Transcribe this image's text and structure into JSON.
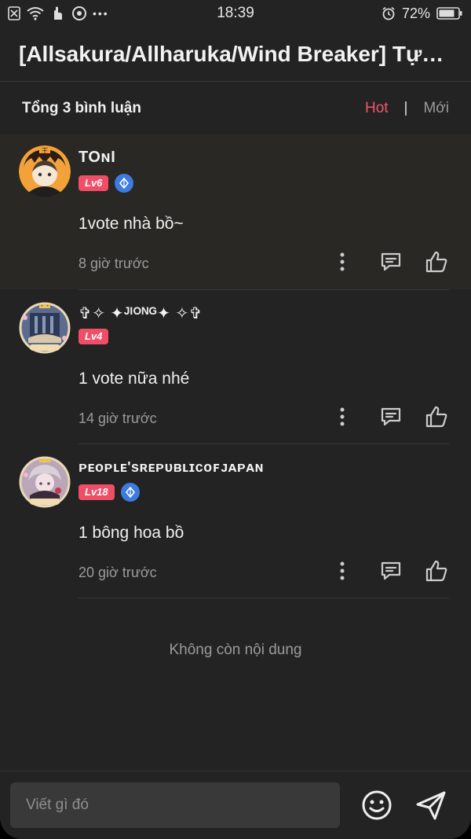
{
  "status_bar": {
    "time": "18:39",
    "battery": "72%",
    "dots": "•••"
  },
  "header": {
    "title": "[Allsakura/Allharuka/Wind Breaker] Tựa..."
  },
  "comment_bar": {
    "count_label": "Tổng 3 bình luận",
    "sort_hot": "Hot",
    "sort_separator": "|",
    "sort_new": "Mới"
  },
  "comments": [
    {
      "username": "TOɴI",
      "level": "Lv6",
      "verified": true,
      "text": "1vote nhà bồ~",
      "time": "8 giờ trước"
    },
    {
      "username": "✞✧ ✦ᴶᴵᴼᴺᴳ✦ ✧✞",
      "level": "Lv4",
      "verified": false,
      "text": "1 vote nữa nhé",
      "time": "14 giờ trước"
    },
    {
      "username": "ᴘᴇᴏᴘʟᴇ'sʀᴇᴘᴜʙʟɪᴄᴏꜰᴊᴀᴘᴀɴ",
      "level": "Lv18",
      "verified": true,
      "text": "1 bông hoa bồ",
      "time": "20 giờ trước"
    }
  ],
  "end_text": "Không còn nội dung",
  "composer": {
    "placeholder": "Viết gì đó"
  },
  "colors": {
    "accent": "#f0556b",
    "level_badge": "#ef4e66",
    "verify_badge": "#3d7be0",
    "background": "#232323"
  },
  "icons": [
    "wifi-icon",
    "signal-icon",
    "chrome-icon",
    "alarm-icon",
    "battery-icon",
    "more-vertical-icon",
    "comment-icon",
    "thumbs-up-icon",
    "emoji-icon",
    "send-icon"
  ]
}
